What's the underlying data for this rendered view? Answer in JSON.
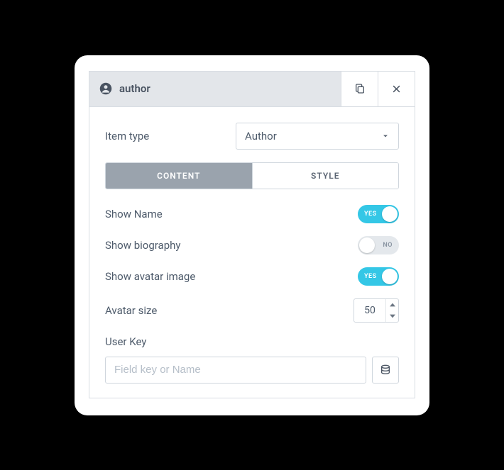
{
  "header": {
    "title": "author"
  },
  "item_type": {
    "label": "Item type",
    "value": "Author"
  },
  "tabs": {
    "content": "CONTENT",
    "style": "STYLE"
  },
  "toggles": {
    "show_name": {
      "label": "Show Name",
      "text": "YES"
    },
    "show_biography": {
      "label": "Show biography",
      "text": "NO"
    },
    "show_avatar": {
      "label": "Show avatar image",
      "text": "YES"
    }
  },
  "avatar_size": {
    "label": "Avatar size",
    "value": "50"
  },
  "user_key": {
    "label": "User Key",
    "placeholder": "Field key or Name"
  }
}
